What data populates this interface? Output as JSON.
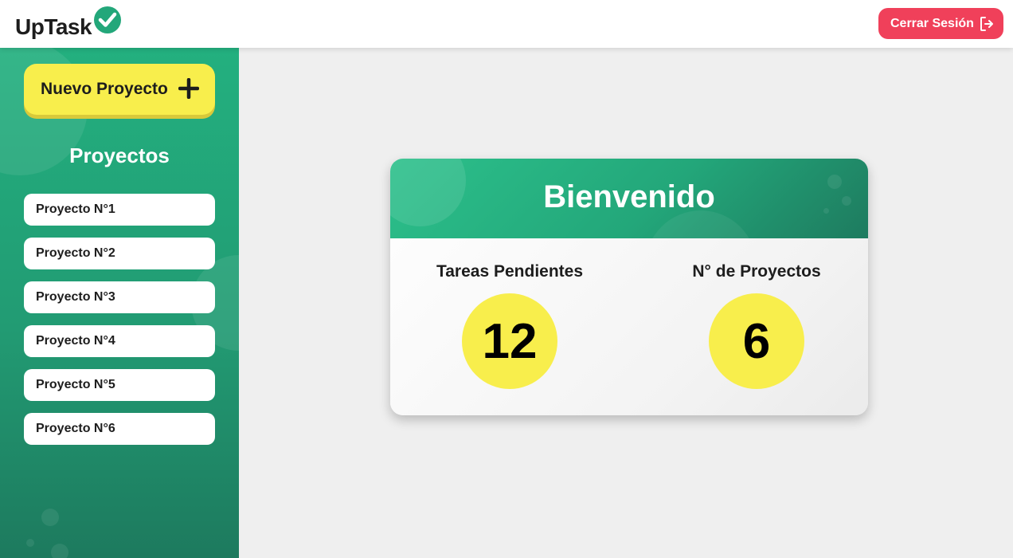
{
  "header": {
    "logo_text": "UpTask",
    "logo_icon": "check-circle-icon",
    "logout_label": "Cerrar Sesión",
    "logout_icon": "logout-icon"
  },
  "sidebar": {
    "new_project_label": "Nuevo Proyecto",
    "new_project_icon": "plus-icon",
    "title": "Proyectos",
    "projects": [
      {
        "label": "Proyecto N°1"
      },
      {
        "label": "Proyecto N°2"
      },
      {
        "label": "Proyecto N°3"
      },
      {
        "label": "Proyecto N°4"
      },
      {
        "label": "Proyecto N°5"
      },
      {
        "label": "Proyecto N°6"
      }
    ]
  },
  "dashboard": {
    "title": "Bienvenido",
    "pending_tasks_label": "Tareas Pendientes",
    "pending_tasks_value": "12",
    "projects_count_label": "N° de Proyectos",
    "projects_count_value": "6"
  },
  "colors": {
    "accent_green": "#23b07f",
    "accent_yellow": "#f8ee4c",
    "logout_red": "#f0405a"
  }
}
